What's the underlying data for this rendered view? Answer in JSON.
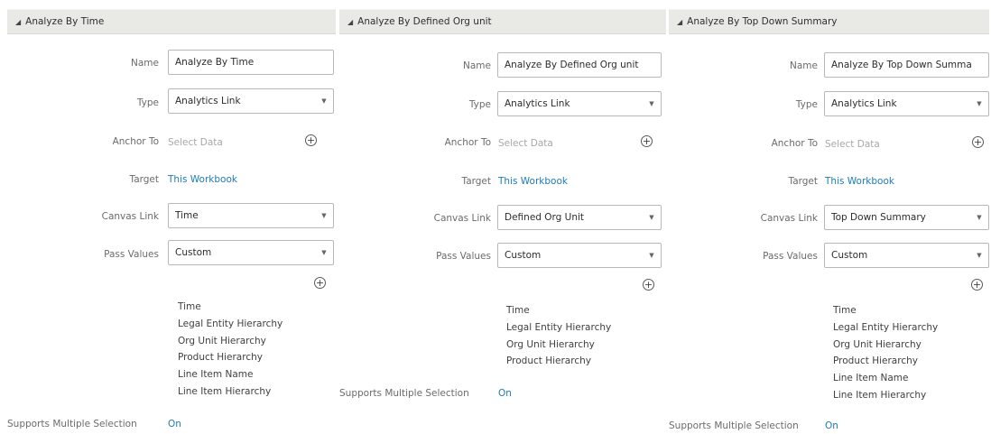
{
  "panels": [
    {
      "header": "Analyze By Time",
      "name_label": "Name",
      "name_value": "Analyze By Time",
      "type_label": "Type",
      "type_value": "Analytics Link",
      "anchor_label": "Anchor To",
      "anchor_placeholder": "Select Data",
      "target_label": "Target",
      "target_value": "This Workbook",
      "canvas_label": "Canvas Link",
      "canvas_value": "Time",
      "pass_label": "Pass Values",
      "pass_value": "Custom",
      "values": [
        "Time",
        "Legal Entity Hierarchy",
        "Org Unit Hierarchy",
        "Product Hierarchy",
        "Line Item Name",
        "Line Item Hierarchy"
      ],
      "multi_label": "Supports Multiple Selection",
      "multi_value": "On"
    },
    {
      "header": "Analyze By Defined Org unit",
      "name_label": "Name",
      "name_value": "Analyze By Defined Org unit",
      "type_label": "Type",
      "type_value": "Analytics Link",
      "anchor_label": "Anchor To",
      "anchor_placeholder": "Select Data",
      "target_label": "Target",
      "target_value": "This Workbook",
      "canvas_label": "Canvas Link",
      "canvas_value": "Defined Org Unit",
      "pass_label": "Pass Values",
      "pass_value": "Custom",
      "values": [
        "Time",
        "Legal Entity Hierarchy",
        "Org Unit Hierarchy",
        "Product Hierarchy"
      ],
      "multi_label": "Supports Multiple Selection",
      "multi_value": "On"
    },
    {
      "header": "Analyze By Top Down Summary",
      "name_label": "Name",
      "name_value": "Analyze By Top Down Summa",
      "type_label": "Type",
      "type_value": "Analytics Link",
      "anchor_label": "Anchor To",
      "anchor_placeholder": "Select Data",
      "target_label": "Target",
      "target_value": "This Workbook",
      "canvas_label": "Canvas Link",
      "canvas_value": "Top Down Summary",
      "pass_label": "Pass Values",
      "pass_value": "Custom",
      "values": [
        "Time",
        "Legal Entity Hierarchy",
        "Org Unit Hierarchy",
        "Product Hierarchy",
        "Line Item Name",
        "Line Item Hierarchy"
      ],
      "multi_label": "Supports Multiple Selection",
      "multi_value": "On"
    }
  ],
  "icons": {
    "collapse": "caret-down-left-icon",
    "dropdown": "chevron-down-icon",
    "add": "add-circle-icon"
  }
}
